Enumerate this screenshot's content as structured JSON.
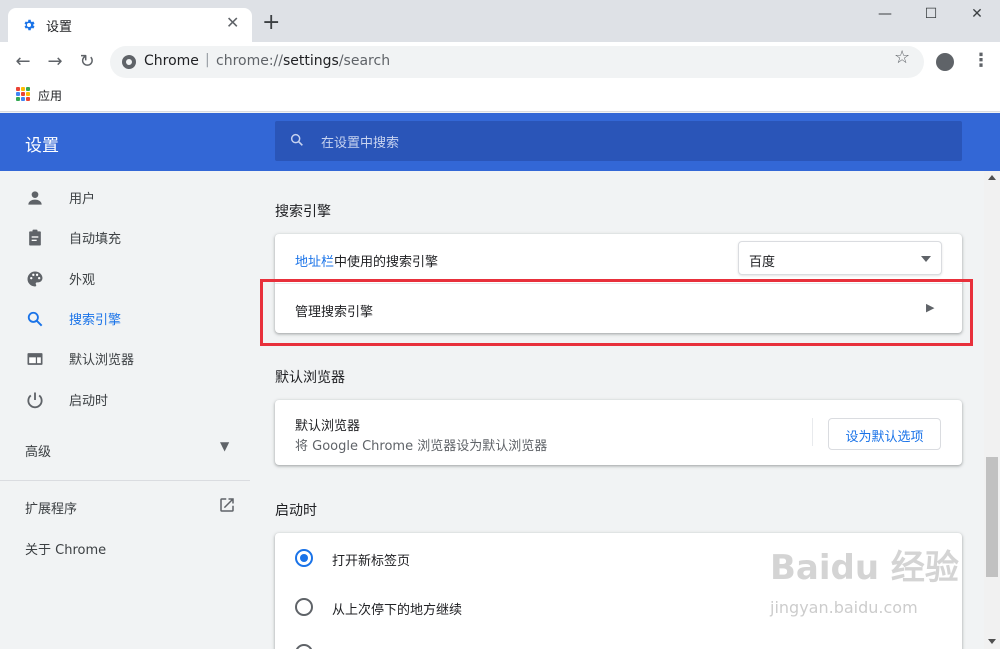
{
  "browser": {
    "tab_title": "设置",
    "new_tab_symbol": "+",
    "window_controls": {
      "minimize": "—",
      "maximize": "☐",
      "close": "✕"
    },
    "omnibox": {
      "site": "Chrome",
      "separator": "|",
      "url_prefix": "chrome://",
      "url_host": "settings",
      "url_path": "/search"
    },
    "bookmarks": {
      "apps_label": "应用"
    },
    "icons": [
      "settings-gear-icon",
      "back-arrow-icon",
      "forward-arrow-icon",
      "reload-icon",
      "site-info-icon",
      "star-icon",
      "profile-icon",
      "kebab-menu-icon",
      "apps-grid-icon"
    ]
  },
  "settings": {
    "header_title": "设置",
    "search_placeholder": "在设置中搜索",
    "accent_color": "#3367d6",
    "link_color": "#1a73e8",
    "sidebar": {
      "items": [
        {
          "label": "用户",
          "icon": "person-icon",
          "active": false
        },
        {
          "label": "自动填充",
          "icon": "clipboard-icon",
          "active": false
        },
        {
          "label": "外观",
          "icon": "palette-icon",
          "active": false
        },
        {
          "label": "搜索引擎",
          "icon": "search-icon",
          "active": true
        },
        {
          "label": "默认浏览器",
          "icon": "browser-window-icon",
          "active": false
        },
        {
          "label": "启动时",
          "icon": "power-icon",
          "active": false
        }
      ],
      "advanced_label": "高级",
      "extensions_label": "扩展程序",
      "about_label": "关于 Chrome"
    },
    "search_engine": {
      "section_title": "搜索引擎",
      "address_bar_link": "地址栏",
      "address_bar_suffix": "中使用的搜索引擎",
      "selected_engine": "百度",
      "manage_label": "管理搜索引擎"
    },
    "default_browser": {
      "section_title": "默认浏览器",
      "row_title": "默认浏览器",
      "row_subtitle": "将 Google Chrome 浏览器设为默认浏览器",
      "button_label": "设为默认选项"
    },
    "on_startup": {
      "section_title": "启动时",
      "options": [
        {
          "label": "打开新标签页",
          "selected": true
        },
        {
          "label": "从上次停下的地方继续",
          "selected": false
        }
      ]
    }
  },
  "annotation": {
    "highlight_color": "#e8303b"
  },
  "watermark": {
    "logo": "Baidu 经验",
    "url": "jingyan.baidu.com"
  }
}
